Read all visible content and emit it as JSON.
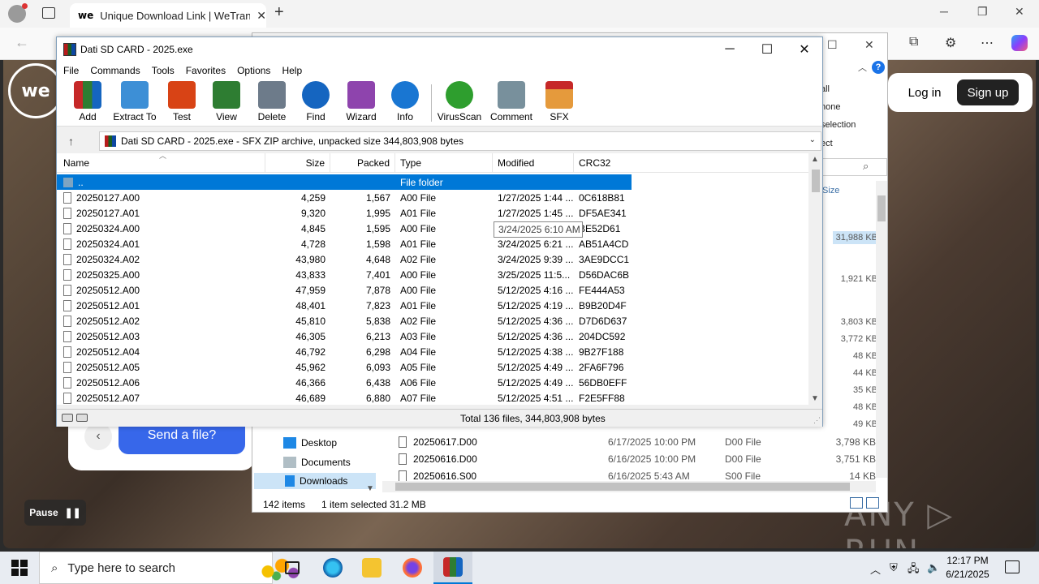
{
  "browser": {
    "tab_title": "Unique Download Link | WeTransf",
    "tab_favicon": "we",
    "new_tab": "+",
    "tab_close": "✕"
  },
  "webpage": {
    "logo": "we",
    "login": "Log in",
    "signup": "Sign up",
    "send_button": "Send a file?",
    "back": "‹",
    "pause": "Pause",
    "watermark": "ANY ▷ RUN"
  },
  "explorer": {
    "ribbon_items": [
      "all",
      "none",
      "selection",
      "ect"
    ],
    "size_header": "Size",
    "sizes": [
      "31,988 KB",
      "1,921 KB",
      "3,803 KB",
      "3,772 KB",
      "48 KB",
      "44 KB",
      "35 KB",
      "48 KB",
      "49 KB"
    ],
    "nav_items": [
      "Desktop",
      "Documents",
      "Downloads"
    ],
    "files": [
      {
        "name": "20250617.D00",
        "date": "6/17/2025 10:00 PM",
        "type": "D00 File",
        "size": "3,798 KB"
      },
      {
        "name": "20250616.D00",
        "date": "6/16/2025 10:00 PM",
        "type": "D00 File",
        "size": "3,751 KB"
      },
      {
        "name": "20250616.S00",
        "date": "6/16/2025 5:43 AM",
        "type": "S00 File",
        "size": "14 KB"
      }
    ],
    "status_items": "142 items",
    "status_selected": "1 item selected  31.2 MB"
  },
  "winrar": {
    "title": "Dati SD CARD - 2025.exe",
    "menu": [
      "File",
      "Commands",
      "Tools",
      "Favorites",
      "Options",
      "Help"
    ],
    "tools": [
      {
        "label": "Add",
        "icon": "add-archive-icon",
        "color": "#c62828"
      },
      {
        "label": "Extract To",
        "icon": "extract-folder-icon",
        "color": "#3d8fd6"
      },
      {
        "label": "Test",
        "icon": "test-clipboard-icon",
        "color": "#d84315"
      },
      {
        "label": "View",
        "icon": "view-book-icon",
        "color": "#2e7d32"
      },
      {
        "label": "Delete",
        "icon": "delete-trash-icon",
        "color": "#6d7b8a"
      },
      {
        "label": "Find",
        "icon": "find-magnifier-icon",
        "color": "#1565c0"
      },
      {
        "label": "Wizard",
        "icon": "wizard-wand-icon",
        "color": "#8e44ad"
      },
      {
        "label": "Info",
        "icon": "info-icon",
        "color": "#1976d2"
      },
      {
        "label": "VirusScan",
        "icon": "virusscan-bug-icon",
        "color": "#2e9e2e"
      },
      {
        "label": "Comment",
        "icon": "comment-icon",
        "color": "#78909c"
      },
      {
        "label": "SFX",
        "icon": "sfx-box-icon",
        "color": "#e59a3c"
      }
    ],
    "address": "Dati SD CARD - 2025.exe - SFX ZIP archive, unpacked size 344,803,908 bytes",
    "columns": {
      "name": "Name",
      "size": "Size",
      "packed": "Packed",
      "type": "Type",
      "modified": "Modified",
      "crc": "CRC32"
    },
    "rows": [
      {
        "name": "..",
        "size": "",
        "packed": "",
        "type": "File folder",
        "modified": "",
        "crc": ""
      },
      {
        "name": "20250127.A00",
        "size": "4,259",
        "packed": "1,567",
        "type": "A00 File",
        "modified": "1/27/2025 1:44 ...",
        "crc": "0C618B81"
      },
      {
        "name": "20250127.A01",
        "size": "9,320",
        "packed": "1,995",
        "type": "A01 File",
        "modified": "1/27/2025 1:45 ...",
        "crc": "DF5AE341"
      },
      {
        "name": "20250324.A00",
        "size": "4,845",
        "packed": "1,595",
        "type": "A00 File",
        "modified": "",
        "crc": "BE52D61"
      },
      {
        "name": "20250324.A01",
        "size": "4,728",
        "packed": "1,598",
        "type": "A01 File",
        "modified": "3/24/2025 6:21 ...",
        "crc": "AB51A4CD"
      },
      {
        "name": "20250324.A02",
        "size": "43,980",
        "packed": "4,648",
        "type": "A02 File",
        "modified": "3/24/2025 9:39 ...",
        "crc": "3AE9DCC1"
      },
      {
        "name": "20250325.A00",
        "size": "43,833",
        "packed": "7,401",
        "type": "A00 File",
        "modified": "3/25/2025 11:5...",
        "crc": "D56DAC6B"
      },
      {
        "name": "20250512.A00",
        "size": "47,959",
        "packed": "7,878",
        "type": "A00 File",
        "modified": "5/12/2025 4:16 ...",
        "crc": "FE444A53"
      },
      {
        "name": "20250512.A01",
        "size": "48,401",
        "packed": "7,823",
        "type": "A01 File",
        "modified": "5/12/2025 4:19 ...",
        "crc": "B9B20D4F"
      },
      {
        "name": "20250512.A02",
        "size": "45,810",
        "packed": "5,838",
        "type": "A02 File",
        "modified": "5/12/2025 4:36 ...",
        "crc": "D7D6D637"
      },
      {
        "name": "20250512.A03",
        "size": "46,305",
        "packed": "6,213",
        "type": "A03 File",
        "modified": "5/12/2025 4:36 ...",
        "crc": "204DC592"
      },
      {
        "name": "20250512.A04",
        "size": "46,792",
        "packed": "6,298",
        "type": "A04 File",
        "modified": "5/12/2025 4:38 ...",
        "crc": "9B27F188"
      },
      {
        "name": "20250512.A05",
        "size": "45,962",
        "packed": "6,093",
        "type": "A05 File",
        "modified": "5/12/2025 4:49 ...",
        "crc": "2FA6F796"
      },
      {
        "name": "20250512.A06",
        "size": "46,366",
        "packed": "6,438",
        "type": "A06 File",
        "modified": "5/12/2025 4:49 ...",
        "crc": "56DB0EFF"
      },
      {
        "name": "20250512.A07",
        "size": "46,689",
        "packed": "6,880",
        "type": "A07 File",
        "modified": "5/12/2025 4:51 ...",
        "crc": "F2E5FF88"
      }
    ],
    "tooltip": "3/24/2025 6:10 AM",
    "status": "Total 136 files, 344,803,908 bytes"
  },
  "taskbar": {
    "search_placeholder": "Type here to search",
    "time": "12:17 PM",
    "date": "6/21/2025"
  }
}
